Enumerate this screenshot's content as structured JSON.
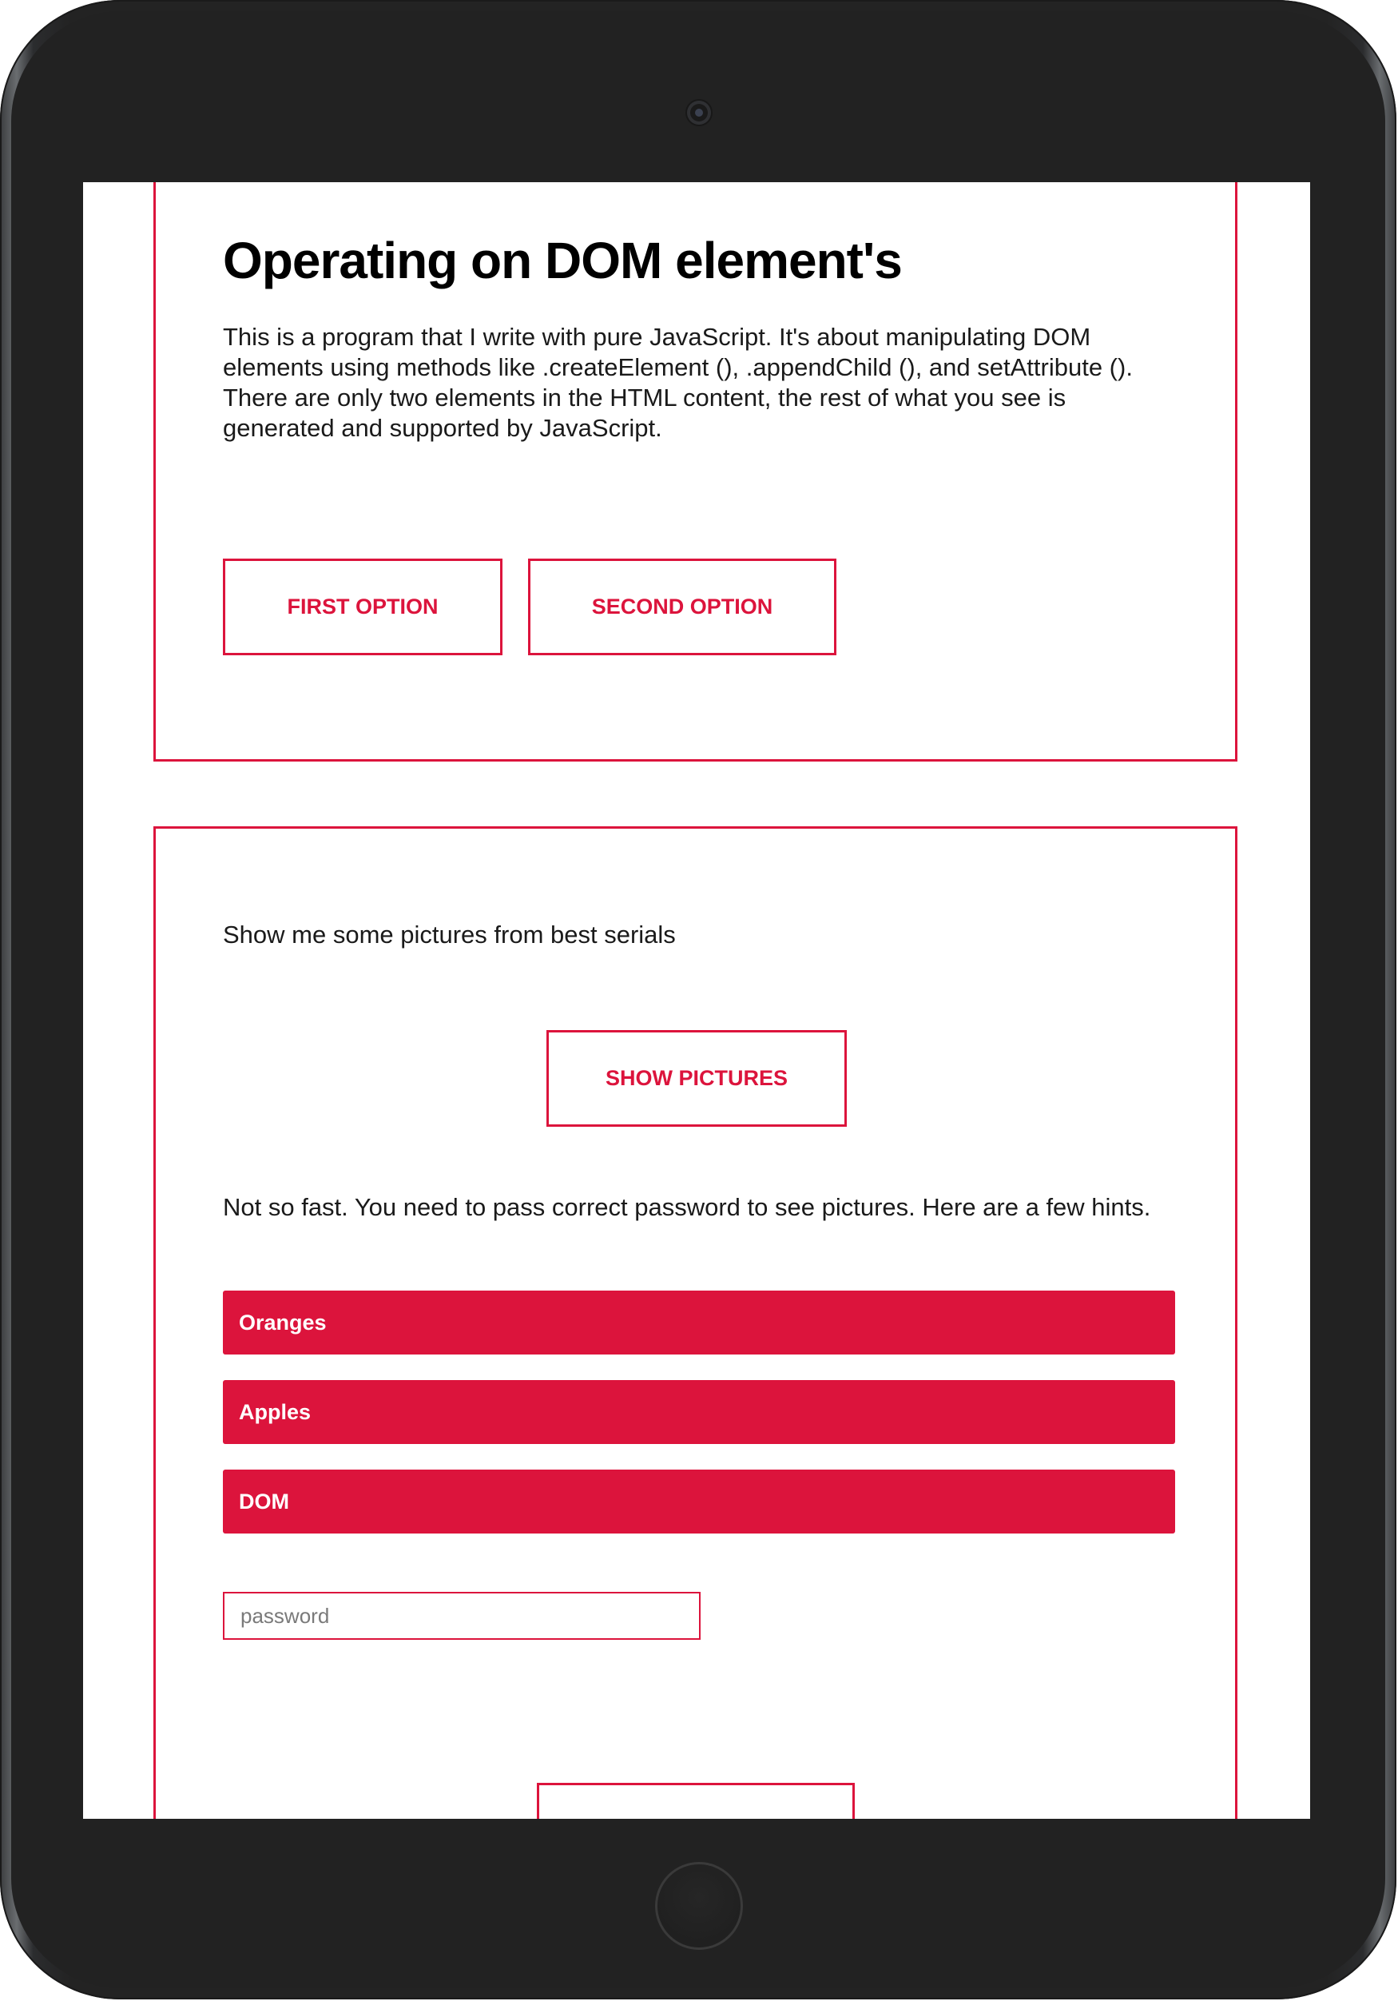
{
  "section_one": {
    "title": "Operating on DOM element's",
    "description": "This is a program that I write with pure JavaScript. It's about manipulating DOM elements using methods like .createElement (), .appendChild (), and setAttribute (). There are only two elements in the HTML content, the rest of what you see is generated and supported by JavaScript.",
    "first_option_label": "FIRST OPTION",
    "second_option_label": "SECOND OPTION"
  },
  "section_two": {
    "prompt": "Show me some pictures from best serials",
    "show_pictures_label": "SHOW PICTURES",
    "hint_intro": "Not so fast. You need to pass correct password to see pictures. Here are a few hints.",
    "hints": [
      "Oranges",
      "Apples",
      "DOM"
    ],
    "password_placeholder": "password",
    "password_value": ""
  },
  "colors": {
    "accent": "#dc143c",
    "device_frame": "#232323",
    "screen_background": "#ffffff",
    "text": "#1a1a1a"
  },
  "icons": {
    "camera": "camera-icon",
    "home_button": "home-button-icon"
  }
}
